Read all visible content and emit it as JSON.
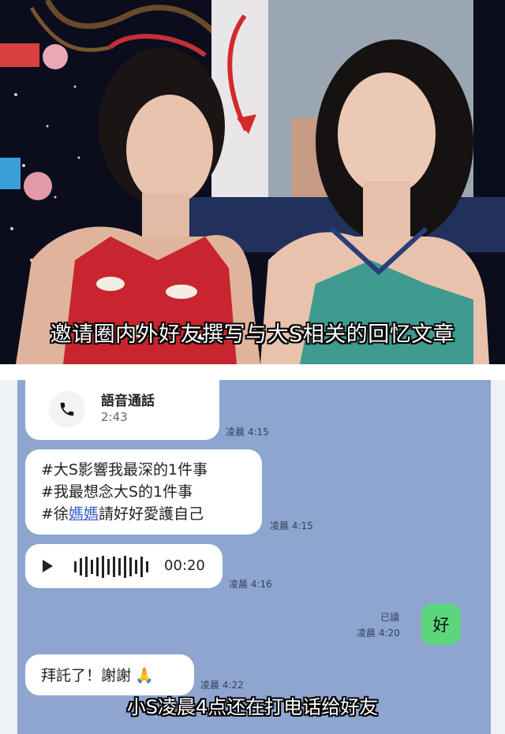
{
  "photo": {
    "caption": "邀请圈内外好友撰写与大S相关的回忆文章",
    "description_icon": "photo-two-women"
  },
  "chat": {
    "call": {
      "title": "語音通話",
      "duration": "2:43",
      "time": "凌晨 4:15"
    },
    "message": {
      "line1": "#大S影響我最深的1件事",
      "line2": "#我最想念大S的1件事",
      "line3_prefix": "#徐",
      "line3_link": "媽媽",
      "line3_suffix": "請好好愛護自己",
      "time": "凌晨 4:15"
    },
    "voice": {
      "duration": "00:20",
      "time": "凌晨 4:16"
    },
    "reply": {
      "text": "好",
      "read": "已讀",
      "time": "凌晨 4:20"
    },
    "thanks": {
      "text": "拜託了！謝謝",
      "emoji": "🙏",
      "time": "凌晨 4:22"
    }
  },
  "caption_bottom": "小S凌晨4点还在打电话给好友",
  "colors": {
    "chat_bg": "#8ea5cf",
    "reply_bubble": "#5bd67b",
    "link": "#3a5fc8"
  }
}
